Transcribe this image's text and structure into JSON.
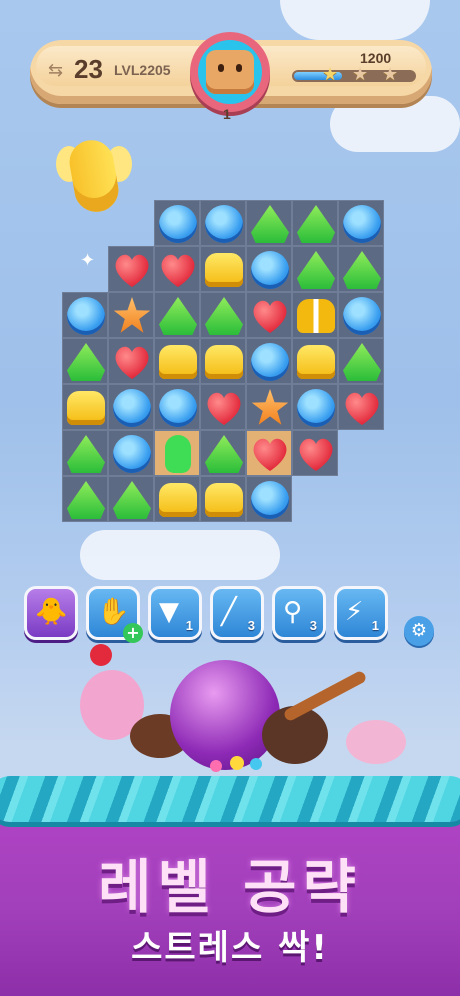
{
  "hud": {
    "moves_left": "23",
    "level_label": "LVL2205",
    "score": "1200",
    "score_progress_percent": 40,
    "stars_earned": 1,
    "stars_total": 3,
    "goal_count": "1",
    "goal_icon": "waffle-cookie-icon"
  },
  "board": {
    "cells": [
      [
        null,
        null,
        "blue",
        "blue",
        "green",
        "green",
        "blue"
      ],
      [
        null,
        "red",
        "red",
        "yellow",
        "blue",
        "green",
        "green"
      ],
      [
        "blue",
        "orange",
        "green",
        "green",
        "red",
        "yellow-striped",
        "blue"
      ],
      [
        "green",
        "red",
        "yellow",
        "yellow",
        "blue",
        "yellow",
        "green"
      ],
      [
        "yellow",
        "blue",
        "blue",
        "red",
        "orange",
        "blue",
        "red"
      ],
      [
        "green",
        "blue",
        "green-jelly",
        "green",
        "red",
        "red",
        null
      ],
      [
        "green",
        "green",
        "yellow",
        "yellow",
        "blue",
        null,
        null
      ]
    ],
    "cookie_cells": [
      [
        5,
        2
      ],
      [
        5,
        4
      ]
    ]
  },
  "boosters": [
    {
      "name": "chick-booster",
      "icon": "chick-icon",
      "count": ""
    },
    {
      "name": "oven-mitt-booster",
      "icon": "oven-mitt-icon",
      "count": "",
      "add": "+"
    },
    {
      "name": "piping-bag-booster",
      "icon": "piping-bag-icon",
      "count": "1"
    },
    {
      "name": "rolling-pin-booster",
      "icon": "rolling-pin-icon",
      "count": "3"
    },
    {
      "name": "spoon-booster",
      "icon": "spoon-icon",
      "count": "3"
    },
    {
      "name": "lightbulb-booster",
      "icon": "lightbulb-icon",
      "count": "1"
    }
  ],
  "settings_icon": "gear-icon",
  "promo": {
    "headline": "레벨 공략",
    "subline": "스트레스 싹!"
  },
  "colors": {
    "promo_background": "#a13fba",
    "promo_headline": "#ffe1f7"
  }
}
